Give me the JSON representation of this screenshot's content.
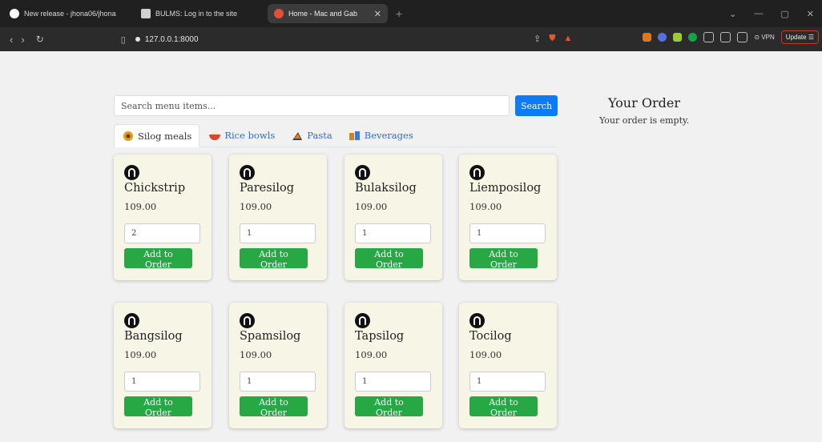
{
  "browser": {
    "tabs": [
      {
        "label": "New release - jhona06/jhona",
        "active": false
      },
      {
        "label": "BULMS: Log in to the site",
        "active": false
      },
      {
        "label": "Home - Mac and Gab",
        "active": true
      }
    ],
    "new_tab": "+",
    "url": "127.0.0.1:8000",
    "vpn_label": "VPN",
    "update_label": "Update"
  },
  "search": {
    "placeholder": "Search menu items...",
    "button_label": "Search"
  },
  "categories": [
    {
      "label": "Silog meals",
      "active": true,
      "icon": "silog-icon"
    },
    {
      "label": "Rice bowls",
      "active": false,
      "icon": "rice-bowl-icon"
    },
    {
      "label": "Pasta",
      "active": false,
      "icon": "pasta-icon"
    },
    {
      "label": "Beverages",
      "active": false,
      "icon": "beverages-icon"
    }
  ],
  "items": [
    {
      "name": "Chickstrip",
      "price": "109.00",
      "qty": "2",
      "button": "Add to Order"
    },
    {
      "name": "Paresilog",
      "price": "109.00",
      "qty": "1",
      "button": "Add to Order"
    },
    {
      "name": "Bulaksilog",
      "price": "109.00",
      "qty": "1",
      "button": "Add to Order"
    },
    {
      "name": "Liemposilog",
      "price": "109.00",
      "qty": "1",
      "button": "Add to Order"
    },
    {
      "name": "Bangsilog",
      "price": "109.00",
      "qty": "1",
      "button": "Add to Order"
    },
    {
      "name": "Spamsilog",
      "price": "109.00",
      "qty": "1",
      "button": "Add to Order"
    },
    {
      "name": "Tapsilog",
      "price": "109.00",
      "qty": "1",
      "button": "Add to Order"
    },
    {
      "name": "Tocilog",
      "price": "109.00",
      "qty": "1",
      "button": "Add to Order"
    }
  ],
  "order": {
    "title": "Your Order",
    "empty_text": "Your order is empty."
  },
  "colors": {
    "search_button": "#0d7bf5",
    "add_button": "#28a745",
    "card_bg": "#f7f5e6",
    "tab_link": "#2a6fd6"
  }
}
